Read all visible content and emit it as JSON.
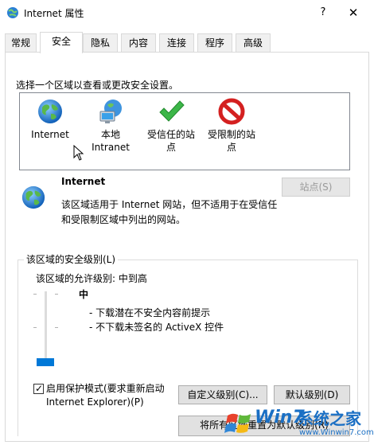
{
  "window": {
    "title": "Internet 属性",
    "help_glyph": "?",
    "close_glyph": "✕"
  },
  "tabs": [
    {
      "label": "常规"
    },
    {
      "label": "安全",
      "active": true
    },
    {
      "label": "隐私"
    },
    {
      "label": "内容"
    },
    {
      "label": "连接"
    },
    {
      "label": "程序"
    },
    {
      "label": "高级"
    }
  ],
  "security": {
    "zone_prompt": "选择一个区域以查看或更改安全设置。",
    "zones": [
      {
        "label": "Internet",
        "icon": "globe-icon"
      },
      {
        "label": "本地\nIntranet",
        "icon": "network-computer-icon"
      },
      {
        "label": "受信任的站\n点",
        "icon": "green-check-icon"
      },
      {
        "label": "受限制的站\n点",
        "icon": "red-prohibited-icon"
      }
    ],
    "selected_zone": {
      "title": "Internet",
      "description": "该区域适用于 Internet 网站，但不适用于在受信任和受限制区域中列出的网站。",
      "sites_button": "站点(S)",
      "sites_button_enabled": false
    },
    "level_group": {
      "title": "该区域的安全级别(L)",
      "allowed_levels": "该区域的允许级别: 中到高",
      "slider_level_fraction": 0.0,
      "level_name": "中",
      "level_bullets": [
        "- 下载潜在不安全内容前提示",
        "- 不下载未签名的 ActiveX 控件"
      ],
      "protected_mode_label": "启用保护模式(要求重新启动 Internet Explorer)(P)",
      "protected_mode_checked": true,
      "custom_level_button": "自定义级别(C)...",
      "default_level_button": "默认级别(D)",
      "reset_all_button": "将所有区域重置为默认级别(R)"
    }
  },
  "watermark": {
    "brand_cn": "系统之家",
    "brand_url": "www.Winwin7.com",
    "logo_text": "Win7"
  },
  "colors": {
    "slider_thumb": "#0078d7",
    "disabled_text": "#9a9a9a",
    "watermark_blue": "#1a6fc4",
    "watermark_red": "#d9261c"
  }
}
